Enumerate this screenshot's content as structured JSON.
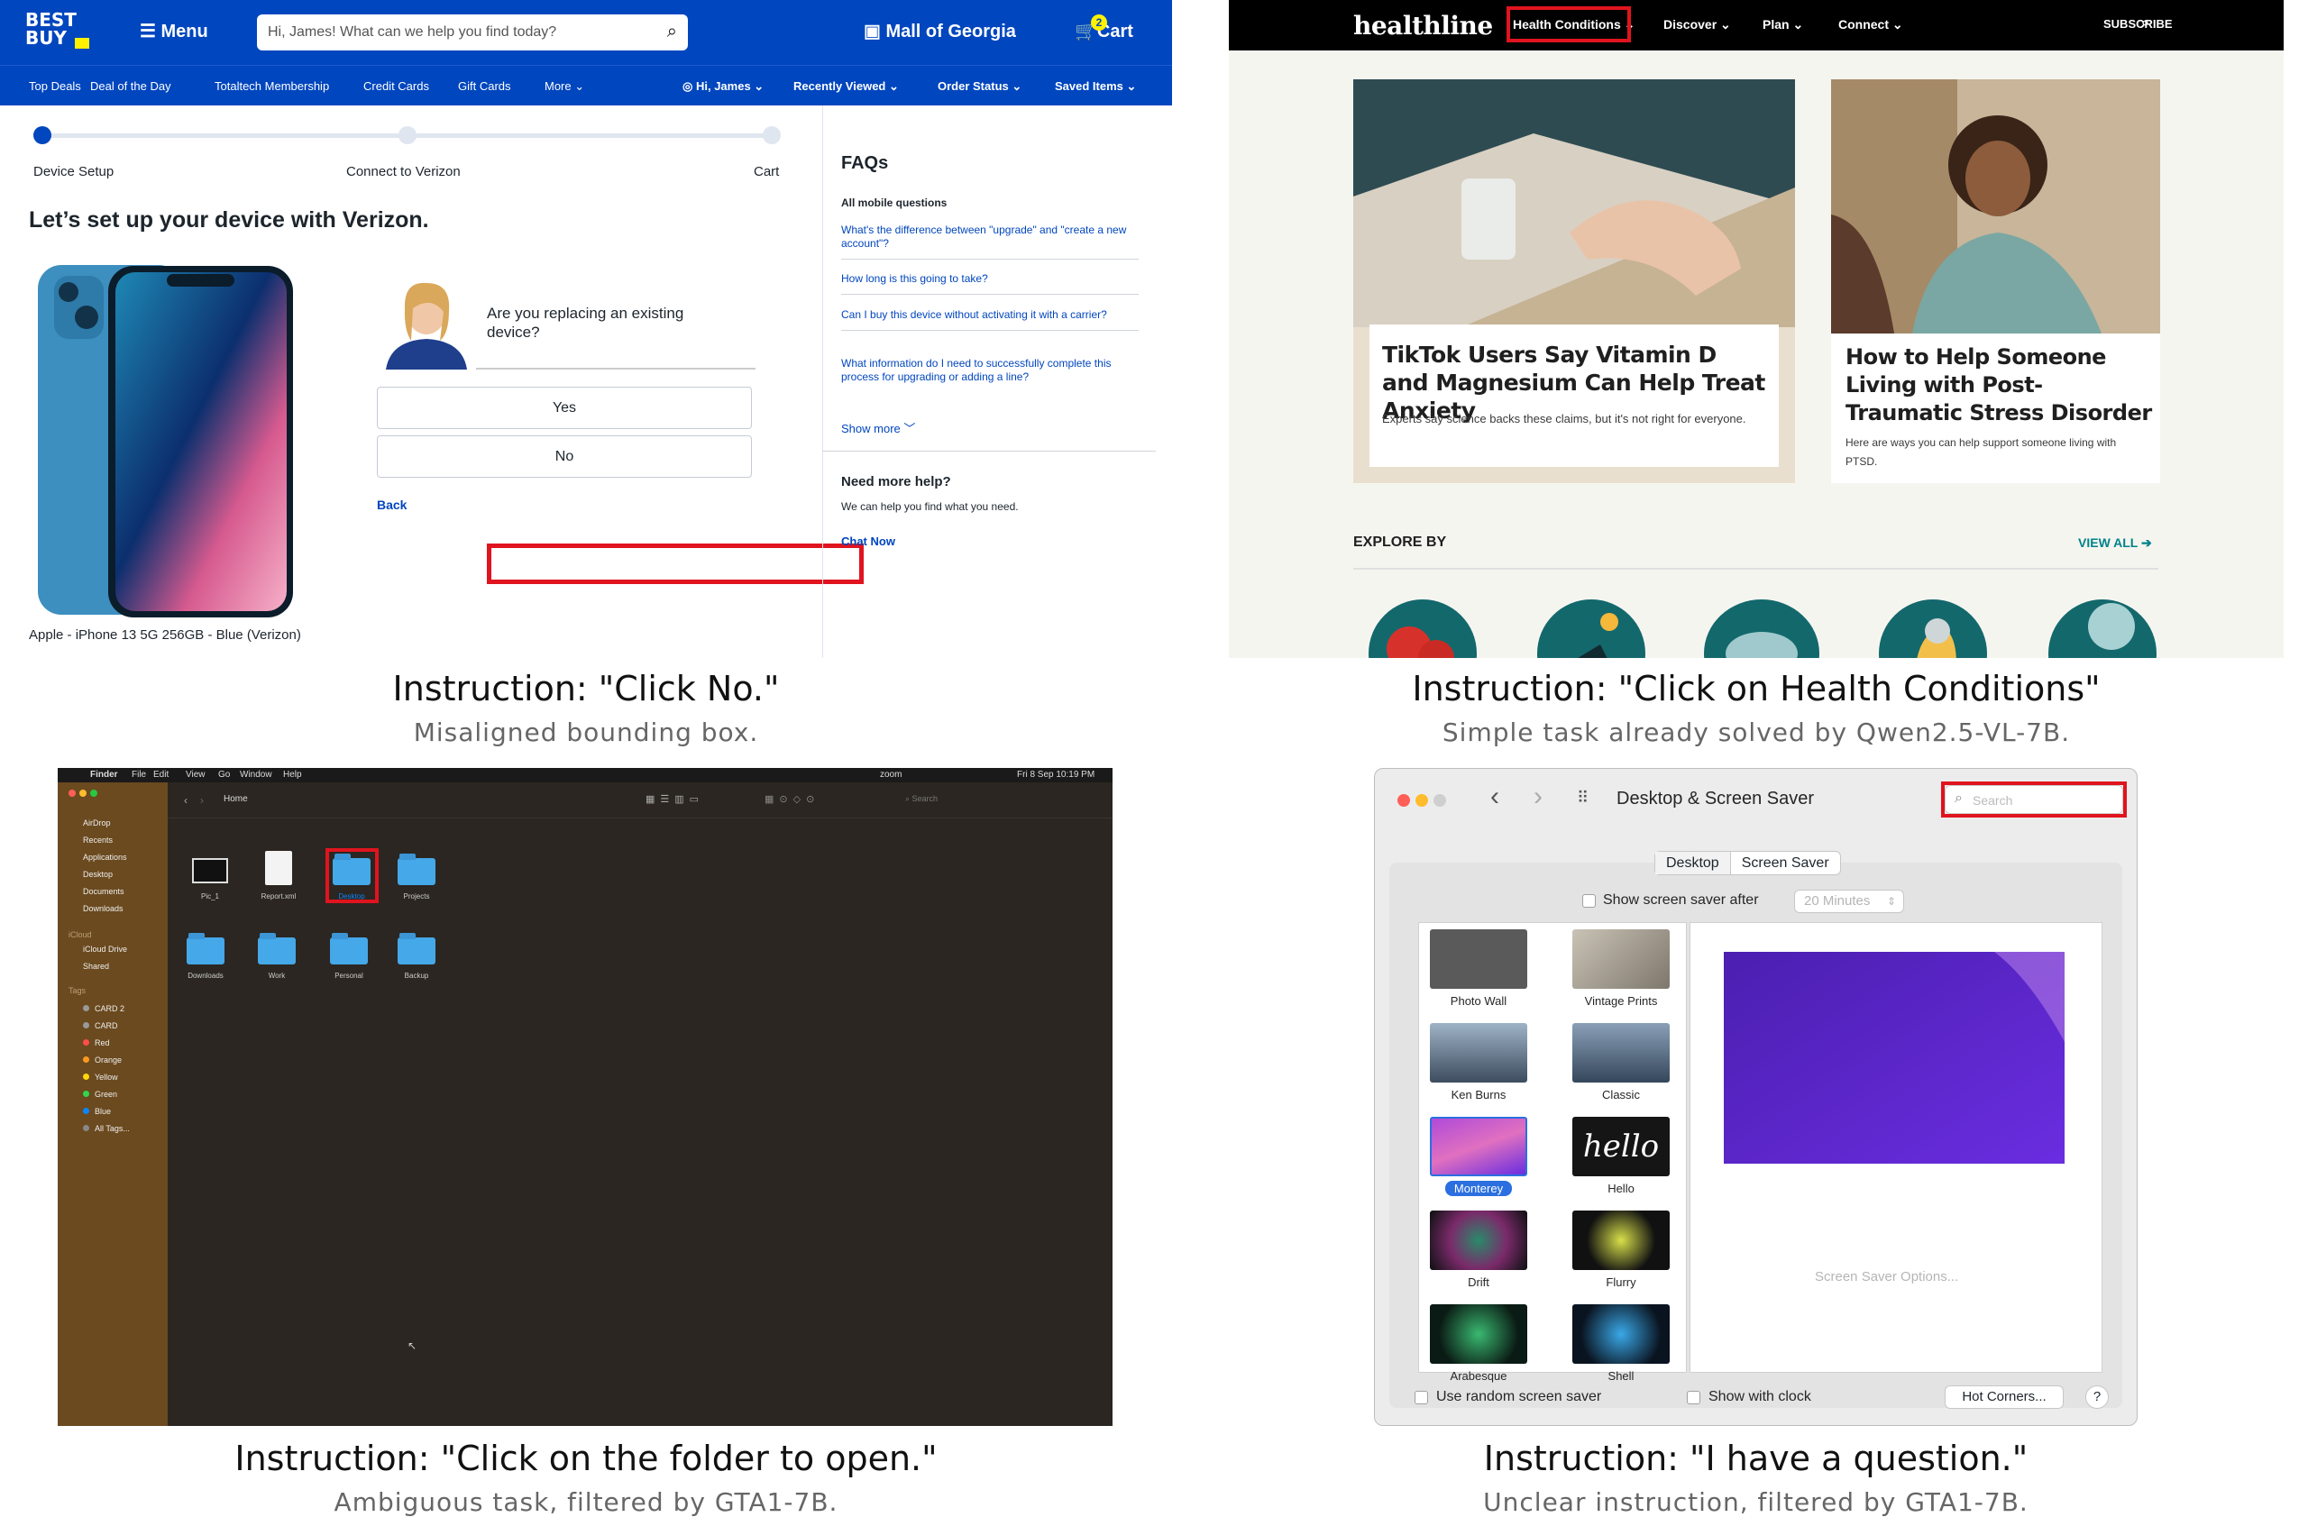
{
  "captions": [
    {
      "instruction": "Instruction: \"Click No.\"",
      "note": "Misaligned bounding box."
    },
    {
      "instruction": "Instruction: \"Click on Health Conditions\"",
      "note": "Simple task already solved by Qwen2.5-VL-7B."
    },
    {
      "instruction": "Instruction: \"Click on the folder to open.\"",
      "note": "Ambiguous task, filtered by GTA1-7B."
    },
    {
      "instruction": "Instruction: \"I have a question.\"",
      "note": "Unclear instruction, filtered by GTA1-7B."
    }
  ],
  "bestbuy": {
    "logo": "BEST BUY",
    "menu": "Menu",
    "search_placeholder": "Hi, James! What can we help you find today?",
    "store": "Mall of Georgia",
    "cart": "Cart",
    "cart_count": "2",
    "nav": [
      "Top Deals",
      "Deal of the Day",
      "Totaltech Membership",
      "Credit Cards",
      "Gift Cards",
      "More"
    ],
    "account_nav": [
      "Hi, James",
      "Recently Viewed",
      "Order Status",
      "Saved Items"
    ],
    "steps": [
      "Device Setup",
      "Connect to Verizon",
      "Cart"
    ],
    "heading": "Let’s set up your device with Verizon.",
    "product": "Apple - iPhone 13 5G 256GB - Blue (Verizon)",
    "question": "Are you replacing an existing device?",
    "yes": "Yes",
    "no": "No",
    "back": "Back",
    "faq_title": "FAQs",
    "faq_section": "All mobile questions",
    "faqs": [
      "What's the difference between \"upgrade\" and \"create a new account\"?",
      "How long is this going to take?",
      "Can I buy this device without activating it with a carrier?",
      "What information do I need to successfully complete this process for upgrading or adding a line?"
    ],
    "show_more": "Show more",
    "help_title": "Need more help?",
    "help_text": "We can help you find what you need.",
    "chat": "Chat Now",
    "brand_color": "#0046be"
  },
  "healthline": {
    "logo": "healthline",
    "nav": [
      "Health Conditions",
      "Discover",
      "Plan",
      "Connect"
    ],
    "subscribe": "SUBSCRIBE",
    "cards": [
      {
        "title": "TikTok Users Say Vitamin D and Magnesium Can Help Treat Anxiety",
        "desc": "Experts say science backs these claims, but it's not right for everyone."
      },
      {
        "title": "How to Help Someone Living with Post-Traumatic Stress Disorder",
        "desc": "Here are ways you can help support someone living with PTSD."
      }
    ],
    "explore": "EXPLORE BY",
    "view_all": "VIEW ALL",
    "accent": "#00838a"
  },
  "finder": {
    "menubar": [
      "Finder",
      "File",
      "Edit",
      "View",
      "Go",
      "Window",
      "Help"
    ],
    "clock": "Fri 8 Sep  10:19 PM",
    "zoom": "zoom",
    "sidebar": [
      "AirDrop",
      "Recents",
      "Applications",
      "Desktop",
      "Documents",
      "Downloads"
    ],
    "icloud_header": "iCloud",
    "icloud": [
      "iCloud Drive",
      "Shared"
    ],
    "tags_header": "Tags",
    "tags": [
      {
        "name": "CARD 2",
        "color": "#999999"
      },
      {
        "name": "CARD",
        "color": "#999999"
      },
      {
        "name": "Red",
        "color": "#ff4d4d"
      },
      {
        "name": "Orange",
        "color": "#ff9a1f"
      },
      {
        "name": "Yellow",
        "color": "#ffd60a"
      },
      {
        "name": "Green",
        "color": "#32d74b"
      },
      {
        "name": "Blue",
        "color": "#0a84ff"
      },
      {
        "name": "All Tags...",
        "color": "#888888"
      }
    ],
    "path": "Home",
    "search": "Search",
    "items": [
      "Pic_1",
      "Report.xml",
      "Desktop",
      "Projects",
      "Downloads",
      "Work",
      "Personal",
      "Backup"
    ]
  },
  "screensaver": {
    "title": "Desktop & Screen Saver",
    "search": "Search",
    "tabs": [
      "Desktop",
      "Screen Saver"
    ],
    "show_after": "Show screen saver after",
    "minutes": "20 Minutes",
    "savers": [
      "Photo Wall",
      "Vintage Prints",
      "Ken Burns",
      "Classic",
      "Monterey",
      "Hello",
      "Drift",
      "Flurry",
      "Arabesque",
      "Shell"
    ],
    "options": "Screen Saver Options...",
    "random": "Use random screen saver",
    "clock": "Show with clock",
    "hot_corners": "Hot Corners...",
    "help": "?"
  }
}
